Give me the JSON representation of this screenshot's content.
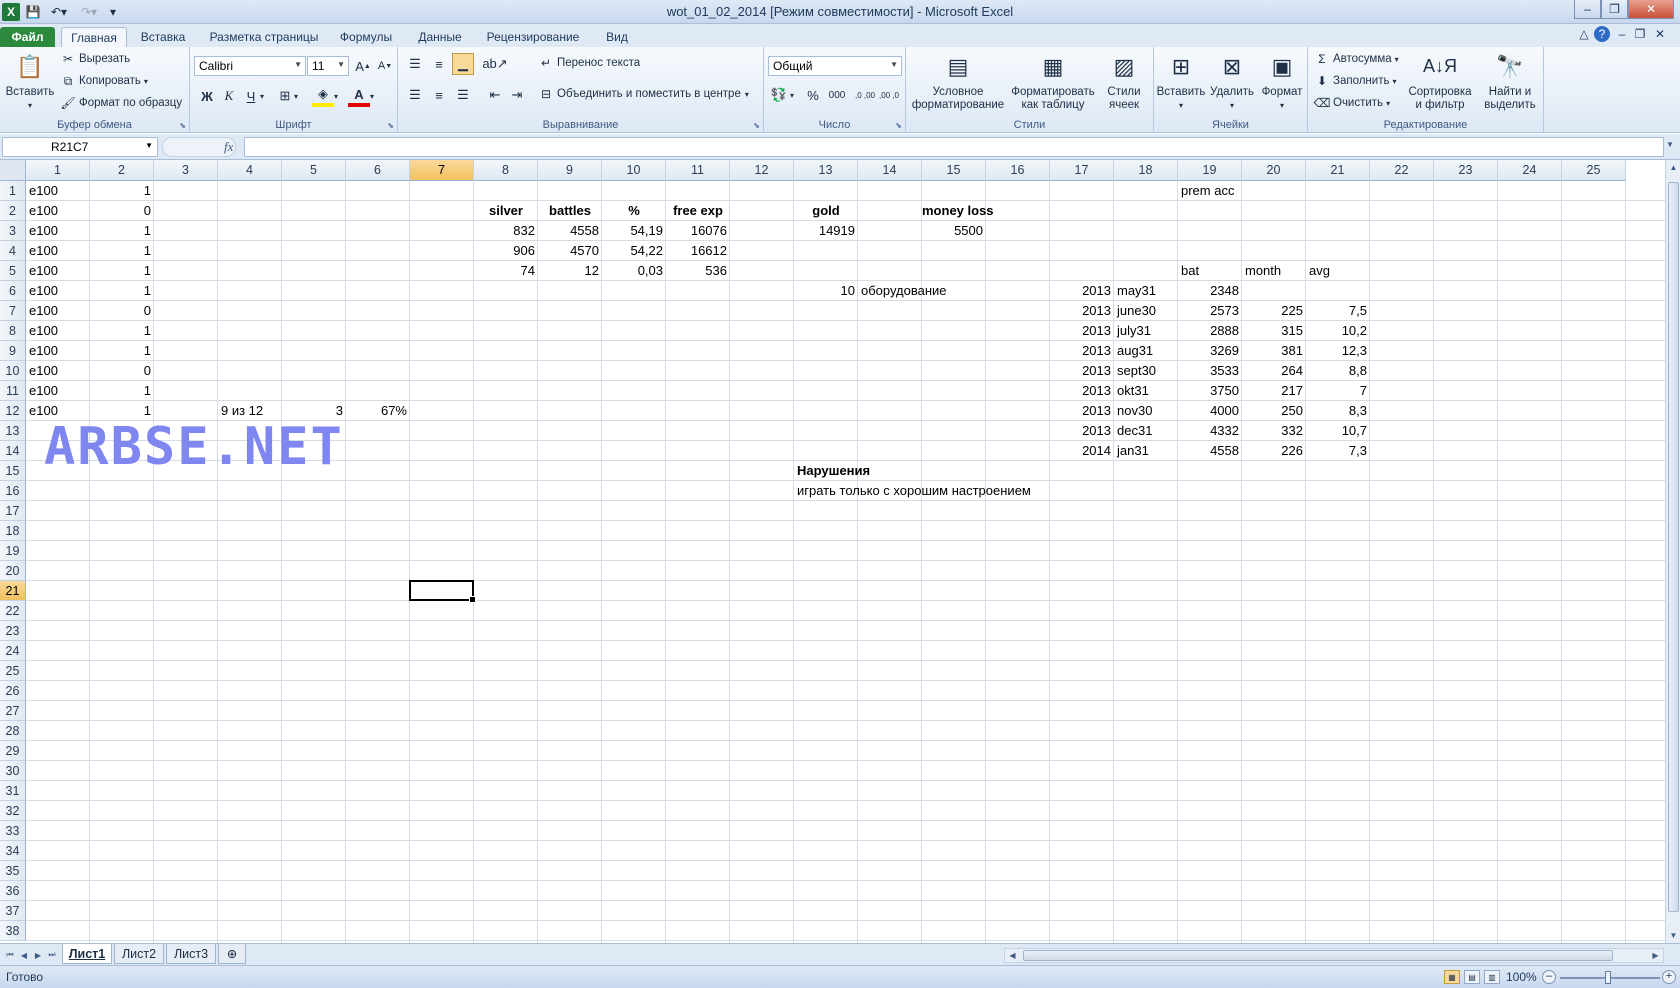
{
  "window": {
    "title": "wot_01_02_2014  [Режим совместимости]  -  Microsoft Excel",
    "app_letter": "X"
  },
  "tabs": [
    {
      "label": "Файл"
    },
    {
      "label": "Главная"
    },
    {
      "label": "Вставка"
    },
    {
      "label": "Разметка страницы"
    },
    {
      "label": "Формулы"
    },
    {
      "label": "Данные"
    },
    {
      "label": "Рецензирование"
    },
    {
      "label": "Вид"
    }
  ],
  "ribbon": {
    "clipboard": {
      "label": "Буфер обмена",
      "paste": "Вставить",
      "cut": "Вырезать",
      "copy": "Копировать",
      "format_painter": "Формат по образцу"
    },
    "font": {
      "label": "Шрифт",
      "name": "Calibri",
      "size": "11",
      "bold": "Ж",
      "italic": "К",
      "underline": "Ч"
    },
    "alignment": {
      "label": "Выравнивание",
      "wrap": "Перенос текста",
      "merge": "Объединить и поместить в центре"
    },
    "number": {
      "label": "Число",
      "format": "Общий",
      "percent": "%",
      "thousands": "000",
      "inc_dec": ",0 ,00",
      "dec_dec": ",00 ,0"
    },
    "styles": {
      "label": "Стили",
      "conditional": "Условное форматирование",
      "as_table": "Форматировать как таблицу",
      "cell_styles": "Стили ячеек"
    },
    "cells": {
      "label": "Ячейки",
      "insert": "Вставить",
      "delete": "Удалить",
      "format": "Формат"
    },
    "editing": {
      "label": "Редактирование",
      "autosum": "Автосумма",
      "fill": "Заполнить",
      "clear": "Очистить",
      "sort": "Сортировка и фильтр",
      "find": "Найти и выделить"
    }
  },
  "formula_bar": {
    "name_box": "R21C7",
    "fx": "fx",
    "formula": ""
  },
  "columns": [
    "1",
    "2",
    "3",
    "4",
    "5",
    "6",
    "7",
    "8",
    "9",
    "10",
    "11",
    "12",
    "13",
    "14",
    "15",
    "16",
    "17",
    "18",
    "19",
    "20",
    "21",
    "22",
    "23",
    "24",
    "25"
  ],
  "rows": [
    "1",
    "2",
    "3",
    "4",
    "5",
    "6",
    "7",
    "8",
    "9",
    "10",
    "11",
    "12",
    "13",
    "14",
    "15",
    "16",
    "17",
    "18",
    "19",
    "20",
    "21",
    "22",
    "23",
    "24",
    "25",
    "26",
    "27",
    "28",
    "29",
    "30",
    "31",
    "32",
    "33",
    "34",
    "35",
    "36",
    "37",
    "38"
  ],
  "selection": {
    "row": 21,
    "col": 7
  },
  "cells": [
    {
      "r": 1,
      "c": 1,
      "v": "e100",
      "a": "l"
    },
    {
      "r": 1,
      "c": 2,
      "v": "1",
      "a": "r"
    },
    {
      "r": 2,
      "c": 1,
      "v": "e100",
      "a": "l"
    },
    {
      "r": 2,
      "c": 2,
      "v": "0",
      "a": "r"
    },
    {
      "r": 3,
      "c": 1,
      "v": "e100",
      "a": "l"
    },
    {
      "r": 3,
      "c": 2,
      "v": "1",
      "a": "r"
    },
    {
      "r": 4,
      "c": 1,
      "v": "e100",
      "a": "l"
    },
    {
      "r": 4,
      "c": 2,
      "v": "1",
      "a": "r"
    },
    {
      "r": 5,
      "c": 1,
      "v": "e100",
      "a": "l"
    },
    {
      "r": 5,
      "c": 2,
      "v": "1",
      "a": "r"
    },
    {
      "r": 6,
      "c": 1,
      "v": "e100",
      "a": "l"
    },
    {
      "r": 6,
      "c": 2,
      "v": "1",
      "a": "r"
    },
    {
      "r": 7,
      "c": 1,
      "v": "e100",
      "a": "l"
    },
    {
      "r": 7,
      "c": 2,
      "v": "0",
      "a": "r"
    },
    {
      "r": 8,
      "c": 1,
      "v": "e100",
      "a": "l"
    },
    {
      "r": 8,
      "c": 2,
      "v": "1",
      "a": "r"
    },
    {
      "r": 9,
      "c": 1,
      "v": "e100",
      "a": "l"
    },
    {
      "r": 9,
      "c": 2,
      "v": "1",
      "a": "r"
    },
    {
      "r": 10,
      "c": 1,
      "v": "e100",
      "a": "l"
    },
    {
      "r": 10,
      "c": 2,
      "v": "0",
      "a": "r"
    },
    {
      "r": 11,
      "c": 1,
      "v": "e100",
      "a": "l"
    },
    {
      "r": 11,
      "c": 2,
      "v": "1",
      "a": "r"
    },
    {
      "r": 12,
      "c": 1,
      "v": "e100",
      "a": "l"
    },
    {
      "r": 12,
      "c": 2,
      "v": "1",
      "a": "r"
    },
    {
      "r": 12,
      "c": 4,
      "v": "9 из 12",
      "a": "l"
    },
    {
      "r": 12,
      "c": 5,
      "v": "3",
      "a": "r"
    },
    {
      "r": 12,
      "c": 6,
      "v": "67%",
      "a": "r"
    },
    {
      "r": 2,
      "c": 8,
      "v": "silver",
      "a": "ctr",
      "b": true
    },
    {
      "r": 2,
      "c": 9,
      "v": "battles",
      "a": "ctr",
      "b": true
    },
    {
      "r": 2,
      "c": 10,
      "v": "%",
      "a": "ctr",
      "b": true
    },
    {
      "r": 2,
      "c": 11,
      "v": "free exp",
      "a": "ctr",
      "b": true
    },
    {
      "r": 2,
      "c": 13,
      "v": "gold",
      "a": "ctr",
      "b": true
    },
    {
      "r": 2,
      "c": 15,
      "v": "money loss",
      "a": "ctr",
      "b": true
    },
    {
      "r": 3,
      "c": 8,
      "v": "832",
      "a": "r"
    },
    {
      "r": 3,
      "c": 9,
      "v": "4558",
      "a": "r"
    },
    {
      "r": 3,
      "c": 10,
      "v": "54,19",
      "a": "r"
    },
    {
      "r": 3,
      "c": 11,
      "v": "16076",
      "a": "r"
    },
    {
      "r": 3,
      "c": 13,
      "v": "14919",
      "a": "r"
    },
    {
      "r": 3,
      "c": 15,
      "v": "5500",
      "a": "r"
    },
    {
      "r": 4,
      "c": 8,
      "v": "906",
      "a": "r"
    },
    {
      "r": 4,
      "c": 9,
      "v": "4570",
      "a": "r"
    },
    {
      "r": 4,
      "c": 10,
      "v": "54,22",
      "a": "r"
    },
    {
      "r": 4,
      "c": 11,
      "v": "16612",
      "a": "r"
    },
    {
      "r": 5,
      "c": 8,
      "v": "74",
      "a": "r"
    },
    {
      "r": 5,
      "c": 9,
      "v": "12",
      "a": "r"
    },
    {
      "r": 5,
      "c": 10,
      "v": "0,03",
      "a": "r"
    },
    {
      "r": 5,
      "c": 11,
      "v": "536",
      "a": "r"
    },
    {
      "r": 1,
      "c": 19,
      "v": "prem acc",
      "a": "l"
    },
    {
      "r": 5,
      "c": 19,
      "v": "bat",
      "a": "l"
    },
    {
      "r": 5,
      "c": 20,
      "v": "month",
      "a": "l"
    },
    {
      "r": 5,
      "c": 21,
      "v": "avg",
      "a": "l"
    },
    {
      "r": 6,
      "c": 13,
      "v": "10",
      "a": "r"
    },
    {
      "r": 6,
      "c": 14,
      "v": "оборудование",
      "a": "l"
    },
    {
      "r": 6,
      "c": 17,
      "v": "2013",
      "a": "r"
    },
    {
      "r": 6,
      "c": 18,
      "v": "may31",
      "a": "l"
    },
    {
      "r": 6,
      "c": 19,
      "v": "2348",
      "a": "r"
    },
    {
      "r": 7,
      "c": 17,
      "v": "2013",
      "a": "r"
    },
    {
      "r": 7,
      "c": 18,
      "v": "june30",
      "a": "l"
    },
    {
      "r": 7,
      "c": 19,
      "v": "2573",
      "a": "r"
    },
    {
      "r": 7,
      "c": 20,
      "v": "225",
      "a": "r"
    },
    {
      "r": 7,
      "c": 21,
      "v": "7,5",
      "a": "r"
    },
    {
      "r": 8,
      "c": 17,
      "v": "2013",
      "a": "r"
    },
    {
      "r": 8,
      "c": 18,
      "v": "july31",
      "a": "l"
    },
    {
      "r": 8,
      "c": 19,
      "v": "2888",
      "a": "r"
    },
    {
      "r": 8,
      "c": 20,
      "v": "315",
      "a": "r"
    },
    {
      "r": 8,
      "c": 21,
      "v": "10,2",
      "a": "r"
    },
    {
      "r": 9,
      "c": 17,
      "v": "2013",
      "a": "r"
    },
    {
      "r": 9,
      "c": 18,
      "v": "aug31",
      "a": "l"
    },
    {
      "r": 9,
      "c": 19,
      "v": "3269",
      "a": "r"
    },
    {
      "r": 9,
      "c": 20,
      "v": "381",
      "a": "r"
    },
    {
      "r": 9,
      "c": 21,
      "v": "12,3",
      "a": "r"
    },
    {
      "r": 10,
      "c": 17,
      "v": "2013",
      "a": "r"
    },
    {
      "r": 10,
      "c": 18,
      "v": "sept30",
      "a": "l"
    },
    {
      "r": 10,
      "c": 19,
      "v": "3533",
      "a": "r"
    },
    {
      "r": 10,
      "c": 20,
      "v": "264",
      "a": "r"
    },
    {
      "r": 10,
      "c": 21,
      "v": "8,8",
      "a": "r"
    },
    {
      "r": 11,
      "c": 17,
      "v": "2013",
      "a": "r"
    },
    {
      "r": 11,
      "c": 18,
      "v": "okt31",
      "a": "l"
    },
    {
      "r": 11,
      "c": 19,
      "v": "3750",
      "a": "r"
    },
    {
      "r": 11,
      "c": 20,
      "v": "217",
      "a": "r"
    },
    {
      "r": 11,
      "c": 21,
      "v": "7",
      "a": "r"
    },
    {
      "r": 12,
      "c": 17,
      "v": "2013",
      "a": "r"
    },
    {
      "r": 12,
      "c": 18,
      "v": "nov30",
      "a": "l"
    },
    {
      "r": 12,
      "c": 19,
      "v": "4000",
      "a": "r"
    },
    {
      "r": 12,
      "c": 20,
      "v": "250",
      "a": "r"
    },
    {
      "r": 12,
      "c": 21,
      "v": "8,3",
      "a": "r"
    },
    {
      "r": 13,
      "c": 17,
      "v": "2013",
      "a": "r"
    },
    {
      "r": 13,
      "c": 18,
      "v": "dec31",
      "a": "l"
    },
    {
      "r": 13,
      "c": 19,
      "v": "4332",
      "a": "r"
    },
    {
      "r": 13,
      "c": 20,
      "v": "332",
      "a": "r"
    },
    {
      "r": 13,
      "c": 21,
      "v": "10,7",
      "a": "r"
    },
    {
      "r": 14,
      "c": 17,
      "v": "2014",
      "a": "r"
    },
    {
      "r": 14,
      "c": 18,
      "v": "jan31",
      "a": "l"
    },
    {
      "r": 14,
      "c": 19,
      "v": "4558",
      "a": "r"
    },
    {
      "r": 14,
      "c": 20,
      "v": "226",
      "a": "r"
    },
    {
      "r": 14,
      "c": 21,
      "v": "7,3",
      "a": "r"
    },
    {
      "r": 15,
      "c": 13,
      "v": "Нарушения",
      "a": "l",
      "b": true
    },
    {
      "r": 16,
      "c": 13,
      "v": "играть только с хорошим настроением",
      "a": "l"
    }
  ],
  "watermark": "ARBSE.NET",
  "sheets": [
    {
      "label": "Лист1"
    },
    {
      "label": "Лист2"
    },
    {
      "label": "Лист3"
    }
  ],
  "status": {
    "ready": "Готово",
    "zoom": "100%"
  },
  "icons": {
    "save": "save-icon",
    "undo": "undo-icon",
    "redo": "redo-icon",
    "paste": "clipboard-icon",
    "cut": "scissors-icon",
    "copy": "copy-icon",
    "painter": "brush-icon",
    "sum": "sigma-icon",
    "find": "binoculars-icon"
  },
  "colors": {
    "accent": "#2b8a3e",
    "selection": "#f1c15f",
    "watermark": "#7f86f0"
  }
}
